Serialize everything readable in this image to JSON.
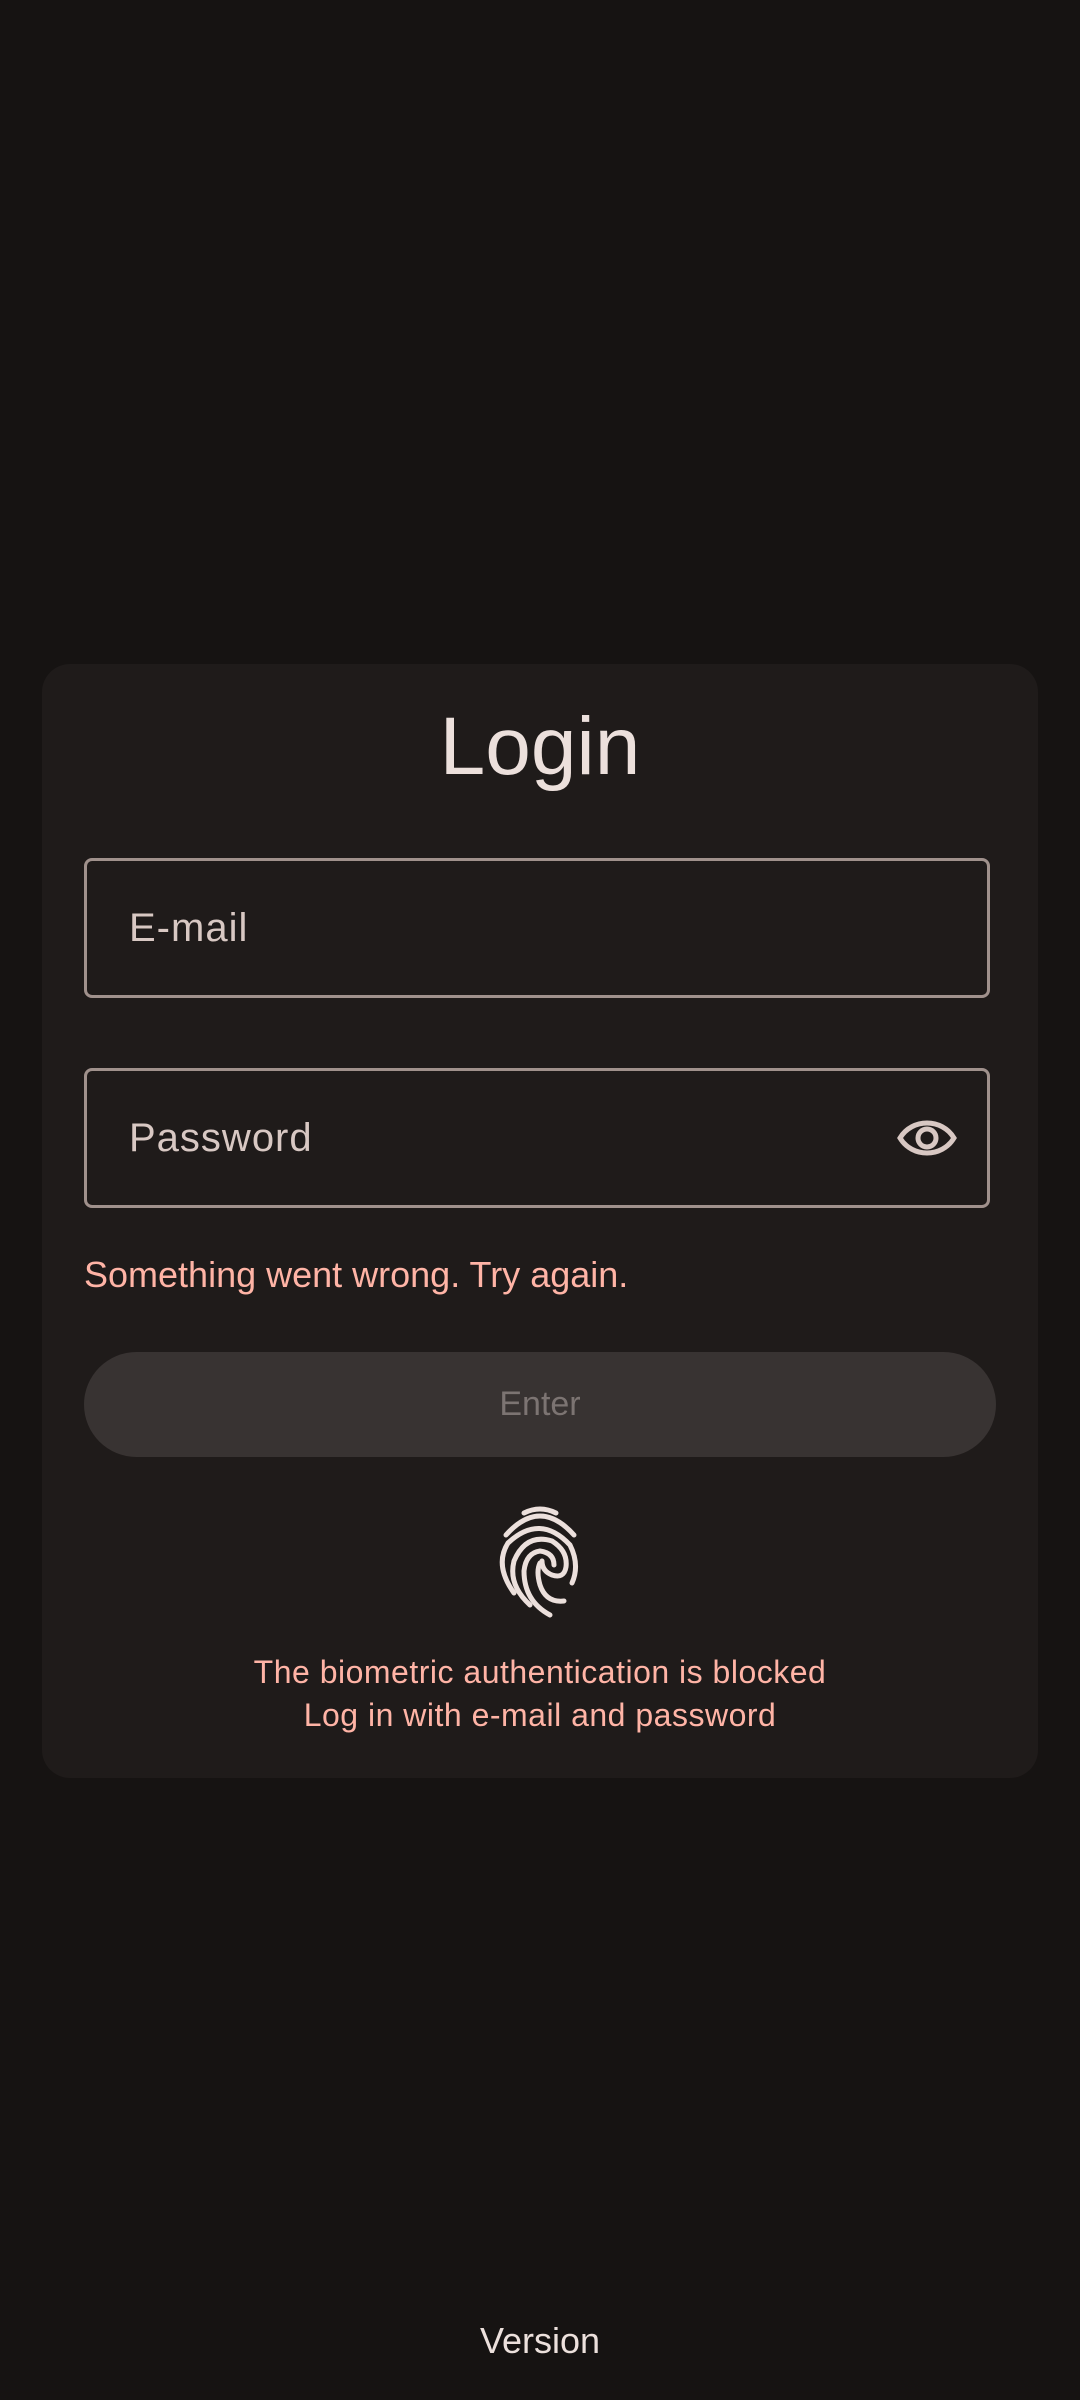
{
  "login": {
    "title": "Login",
    "email_placeholder": "E-mail",
    "password_placeholder": "Password",
    "password_toggle_icon": "eye-icon",
    "error_message": "Something went wrong. Try again.",
    "enter_label": "Enter",
    "biometric_icon": "fingerprint-icon",
    "biometric_blocked": "The biometric authentication is blocked",
    "biometric_hint": "Log in with e-mail and password"
  },
  "footer": {
    "version_label": "Version"
  },
  "colors": {
    "background": "#161312",
    "card": "#1f1b1a",
    "error": "#ffb4a6",
    "outline": "#a0918c"
  }
}
